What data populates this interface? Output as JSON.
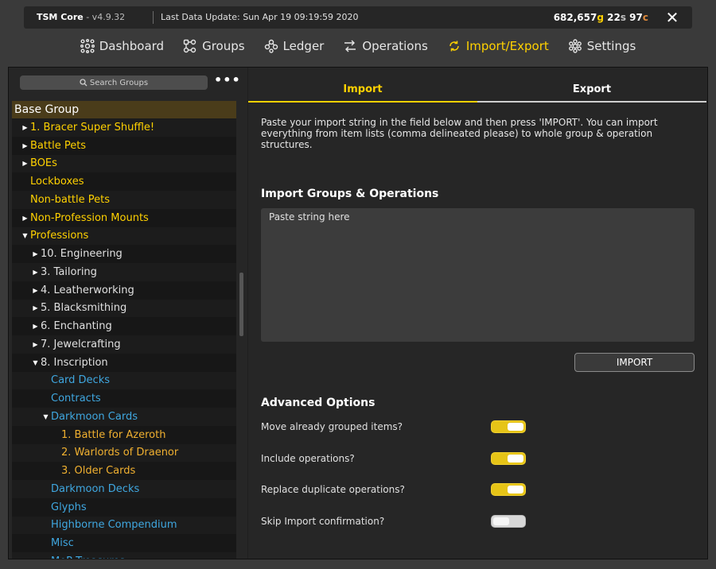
{
  "titlebar": {
    "app_name": "TSM Core",
    "version": "- v4.9.32",
    "last_update": "Last Data Update: Sun Apr 19 09:19:59 2020"
  },
  "gold": {
    "gold": "682,657",
    "gold_unit": "g",
    "silver": "22",
    "silver_unit": "s",
    "copper": "97",
    "copper_unit": "c"
  },
  "nav": [
    {
      "label": "Dashboard",
      "icon": "dashboard-icon",
      "active": false
    },
    {
      "label": "Groups",
      "icon": "groups-icon",
      "active": false
    },
    {
      "label": "Ledger",
      "icon": "ledger-icon",
      "active": false
    },
    {
      "label": "Operations",
      "icon": "operations-icon",
      "active": false
    },
    {
      "label": "Import/Export",
      "icon": "import-export-icon",
      "active": true
    },
    {
      "label": "Settings",
      "icon": "settings-icon",
      "active": false
    }
  ],
  "search": {
    "placeholder": "Search Groups"
  },
  "tree": {
    "base": "Base Group",
    "items": [
      {
        "label": "1. Bracer Super Shuffle!",
        "arrow": "right"
      },
      {
        "label": "Battle Pets",
        "arrow": "right"
      },
      {
        "label": "BOEs",
        "arrow": "right"
      },
      {
        "label": "Lockboxes",
        "arrow": ""
      },
      {
        "label": "Non-battle Pets",
        "arrow": ""
      },
      {
        "label": "Non-Profession Mounts",
        "arrow": "right"
      },
      {
        "label": "Professions",
        "arrow": "down"
      },
      {
        "label": "10. Engineering",
        "arrow": "right"
      },
      {
        "label": "3. Tailoring",
        "arrow": "right"
      },
      {
        "label": "4. Leatherworking",
        "arrow": "right"
      },
      {
        "label": "5. Blacksmithing",
        "arrow": "right"
      },
      {
        "label": "6. Enchanting",
        "arrow": "right"
      },
      {
        "label": "7. Jewelcrafting",
        "arrow": "right"
      },
      {
        "label": "8. Inscription",
        "arrow": "down"
      },
      {
        "label": "Card Decks",
        "arrow": ""
      },
      {
        "label": "Contracts",
        "arrow": ""
      },
      {
        "label": "Darkmoon Cards",
        "arrow": "down"
      },
      {
        "label": "1. Battle for Azeroth",
        "arrow": ""
      },
      {
        "label": "2. Warlords of Draenor",
        "arrow": ""
      },
      {
        "label": "3. Older Cards",
        "arrow": ""
      },
      {
        "label": "Darkmoon Decks",
        "arrow": ""
      },
      {
        "label": "Glyphs",
        "arrow": ""
      },
      {
        "label": "Highborne Compendium",
        "arrow": ""
      },
      {
        "label": "Misc",
        "arrow": ""
      },
      {
        "label": "MoP Treasures",
        "arrow": ""
      }
    ]
  },
  "tabs": {
    "import": "Import",
    "export": "Export"
  },
  "import": {
    "intro": "Paste your import string in the field below and then press 'IMPORT'. You can import everything from item lists (comma delineated please) to whole group & operation structures.",
    "heading": "Import Groups & Operations",
    "paste_placeholder": "Paste string here",
    "button": "IMPORT"
  },
  "advanced": {
    "heading": "Advanced Options",
    "options": [
      {
        "label": "Move already grouped items?",
        "on": true
      },
      {
        "label": "Include operations?",
        "on": true
      },
      {
        "label": "Replace duplicate operations?",
        "on": true
      },
      {
        "label": "Skip Import confirmation?",
        "on": false
      }
    ]
  },
  "colors": {
    "accent": "#ffd100",
    "group_yellow": "#ffd100",
    "group_blue": "#3fa7e0",
    "group_gold": "#f0b030"
  }
}
